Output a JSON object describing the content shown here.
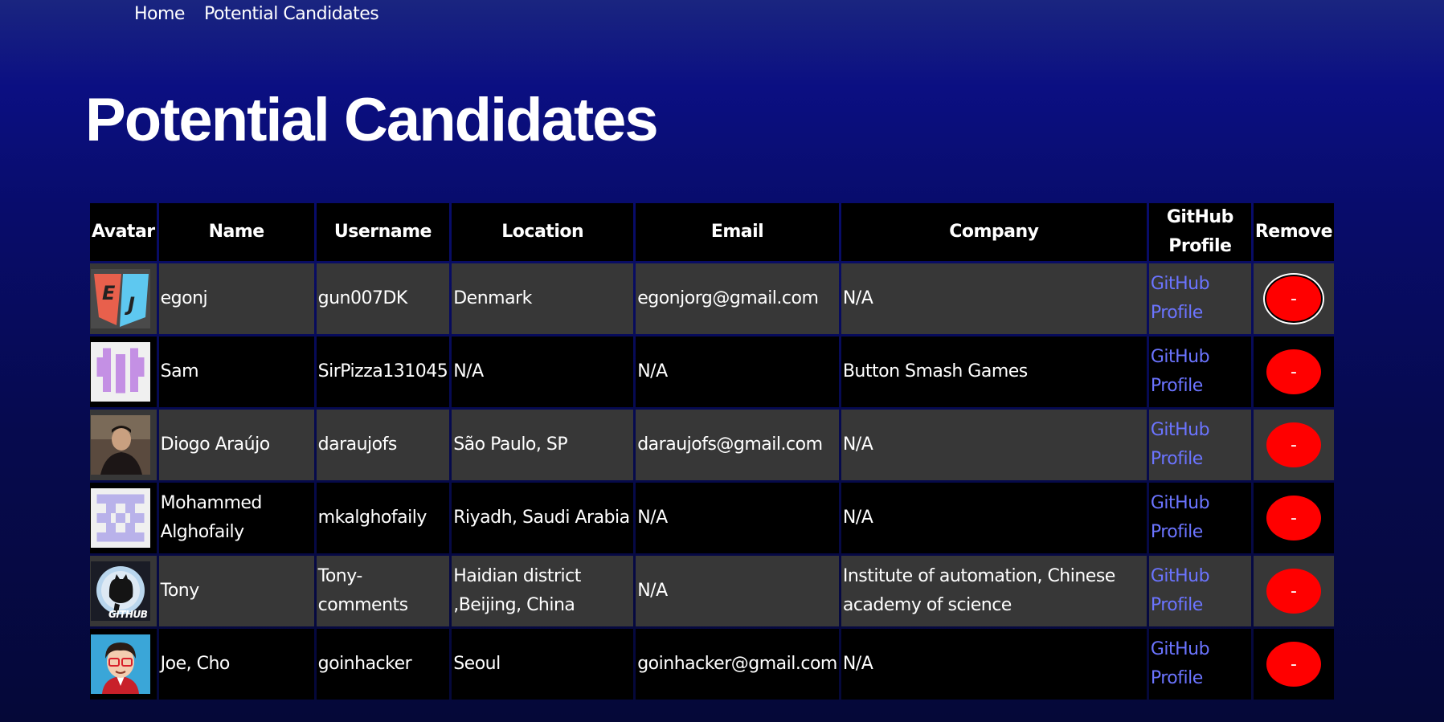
{
  "nav": {
    "home": "Home",
    "candidates": "Potential Candidates"
  },
  "page_title": "Potential Candidates",
  "columns": {
    "avatar": "Avatar",
    "name": "Name",
    "username": "Username",
    "location": "Location",
    "email": "Email",
    "company": "Company",
    "github_line1": "GitHub",
    "github_line2": "Profile",
    "remove": "Remove"
  },
  "link_text": {
    "line1": "GitHub",
    "line2": "Profile"
  },
  "remove_label": "-",
  "colors": {
    "accent_link": "#6b74ff",
    "remove_button": "#ff0000",
    "row_odd": "#373737",
    "row_even": "#000000"
  },
  "rows": [
    {
      "avatar_icon": "ej-shield-avatar",
      "name": "egonj",
      "username": "gun007DK",
      "location": "Denmark",
      "email": "egonjorg@gmail.com",
      "company": "N/A"
    },
    {
      "avatar_icon": "purple-identicon-avatar",
      "name": "Sam",
      "username": "SirPizza131045",
      "location": "N/A",
      "email": "N/A",
      "company": "Button Smash Games"
    },
    {
      "avatar_icon": "photo-avatar",
      "name": "Diogo Araújo",
      "username": "daraujofs",
      "location": "São Paulo, SP",
      "email": "daraujofs@gmail.com",
      "company": "N/A"
    },
    {
      "avatar_icon": "lavender-identicon-avatar",
      "name": "Mohammed Alghofaily",
      "username": "mkalghofaily",
      "location": "Riyadh, Saudi Arabia",
      "email": "N/A",
      "company": "N/A"
    },
    {
      "avatar_icon": "github-octocat-avatar",
      "name": "Tony",
      "username": "Tony-comments",
      "location": "Haidian district ,Beijing, China",
      "email": "N/A",
      "company": "Institute of automation, Chinese academy of science"
    },
    {
      "avatar_icon": "cartoon-avatar",
      "name": "Joe, Cho",
      "username": "goinhacker",
      "location": "Seoul",
      "email": "goinhacker@gmail.com",
      "company": "N/A"
    }
  ]
}
